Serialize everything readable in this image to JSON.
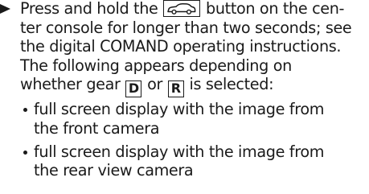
{
  "instruction": {
    "line1_a": "Press and hold the",
    "line1_b": "button on the cen-",
    "line2": "ter console for longer than two seconds; see",
    "line3": "the digital COMAND operating instructions.",
    "line4": "The following appears depending on",
    "line5_a": "whether gear",
    "gear_d": "D",
    "line5_or": "or",
    "gear_r": "R",
    "line5_b": "is selected:",
    "car_button_icon": "car-camera-button-icon"
  },
  "options": [
    {
      "line1": "full screen display with the image from",
      "line2": "the front camera"
    },
    {
      "line1": "full screen display with the image from",
      "line2": "the rear view camera"
    }
  ]
}
